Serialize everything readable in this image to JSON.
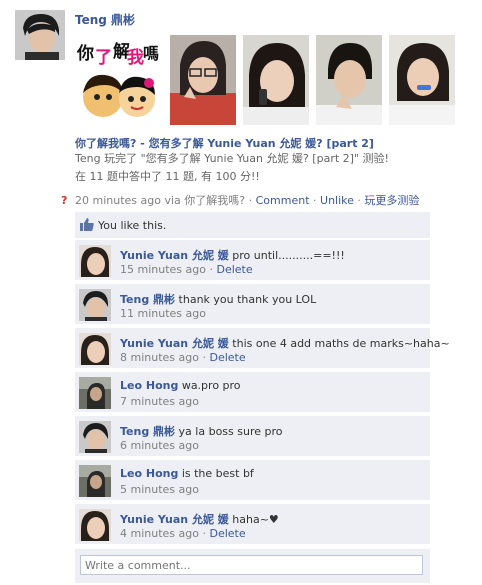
{
  "post": {
    "author": "Teng 鼎彬",
    "app_title": "你了解我嗎? - 您有多了解 Yunie Yuan 允妮 媛? [part 2]",
    "app_desc": "Teng 玩完了 \"您有多了解 Yunie Yuan 允妮 媛? [part 2]\" 测验!",
    "app_score": "在 11 题中答中了 11 题, 有 100 分!!",
    "logo_text": "你了解我嗎"
  },
  "meta": {
    "time": "20 minutes ago via 你了解我嗎? · ",
    "comment": "Comment",
    "sep1": " · ",
    "unlike": "Unlike",
    "sep2": " · ",
    "more": "玩更多测验"
  },
  "like": {
    "text": "You like this."
  },
  "comments": [
    {
      "name": "Yunie Yuan 允妮 媛",
      "text": " pro until..........==!!!",
      "time": "15 minutes ago",
      "delete": "Delete"
    },
    {
      "name": "Teng 鼎彬",
      "text": " thank you thank you LOL",
      "time": "11 minutes ago",
      "delete": ""
    },
    {
      "name": "Yunie Yuan 允妮 媛",
      "text": " this one 4 add maths de marks~haha~",
      "time": "8 minutes ago",
      "delete": "Delete"
    },
    {
      "name": "Leo Hong",
      "text": " wa.pro pro",
      "time": "7 minutes ago",
      "delete": ""
    },
    {
      "name": "Teng 鼎彬",
      "text": " ya la boss sure pro",
      "time": "6 minutes ago",
      "delete": ""
    },
    {
      "name": "Leo Hong",
      "text": " is the best bf",
      "time": "5 minutes ago",
      "delete": ""
    },
    {
      "name": "Yunie Yuan 允妮 媛",
      "text": " haha~♥",
      "time": "4 minutes ago",
      "delete": "Delete"
    }
  ],
  "composer": {
    "placeholder": "Write a comment..."
  },
  "colors": {
    "link": "#3b5998",
    "panel": "#edeff4",
    "muted": "#808080"
  }
}
